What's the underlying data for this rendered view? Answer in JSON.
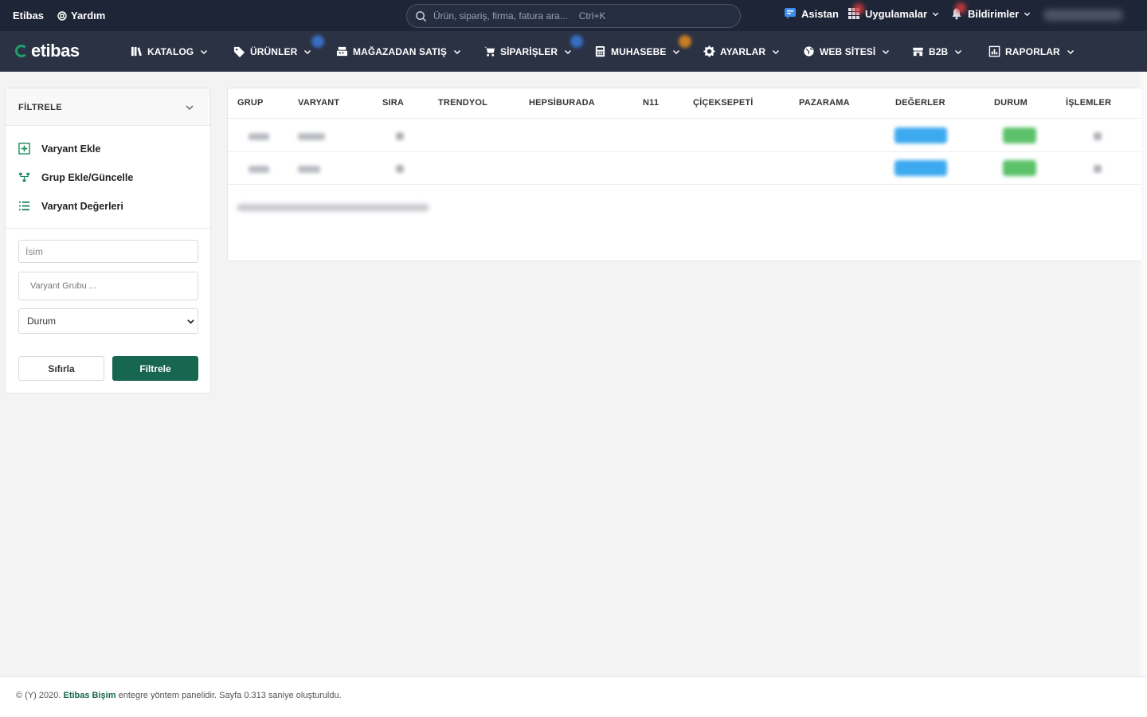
{
  "topbar": {
    "brand": "Etibas",
    "help": "Yardım",
    "search_placeholder": "Ürün, sipariş, firma, fatura ara...",
    "search_shortcut": "Ctrl+K",
    "assistant": "Asistan",
    "apps": "Uygulamalar",
    "notifications": "Bildirimler"
  },
  "nav": {
    "logo": "etibas",
    "items": [
      {
        "label": "KATALOG",
        "icon": "books-icon"
      },
      {
        "label": "ÜRÜNLER",
        "icon": "tag-icon"
      },
      {
        "label": "MAĞAZADAN SATIŞ",
        "icon": "register-icon"
      },
      {
        "label": "SİPARİŞLER",
        "icon": "cart-icon"
      },
      {
        "label": "MUHASEBE",
        "icon": "calculator-icon"
      },
      {
        "label": "AYARLAR",
        "icon": "gear-icon"
      },
      {
        "label": "WEB SİTESİ",
        "icon": "globe-icon"
      },
      {
        "label": "B2B",
        "icon": "store-icon"
      },
      {
        "label": "RAPORLAR",
        "icon": "report-icon"
      }
    ]
  },
  "filter": {
    "title": "FİLTRELE",
    "links": [
      {
        "label": "Varyant Ekle",
        "icon": "add-variant-icon"
      },
      {
        "label": "Grup Ekle/Güncelle",
        "icon": "group-icon"
      },
      {
        "label": "Varyant Değerleri",
        "icon": "list-icon"
      }
    ],
    "name_placeholder": "İsim",
    "group_placeholder": "Varyant Grubu ...",
    "status_selected": "Durum",
    "reset_label": "Sıfırla",
    "submit_label": "Filtrele"
  },
  "table": {
    "columns": [
      "GRUP",
      "VARYANT",
      "SIRA",
      "TRENDYOL",
      "HEPSİBURADA",
      "N11",
      "ÇİÇEKSEPETİ",
      "PAZARAMA",
      "DEĞERLER",
      "DURUM",
      "İŞLEMLER"
    ]
  },
  "footer": {
    "prefix": "© (Y) 2020.",
    "company": "Etibas Bişim",
    "suffix": "entegre yöntem panelidir. Sayfa 0.313 saniye oluşturuldu."
  },
  "colors": {
    "topbar_bg": "#1e2536",
    "nav_bg": "#2a3244",
    "primary": "#17664f",
    "badge_blue": "#3da9ef",
    "badge_green": "#5cc26a"
  }
}
